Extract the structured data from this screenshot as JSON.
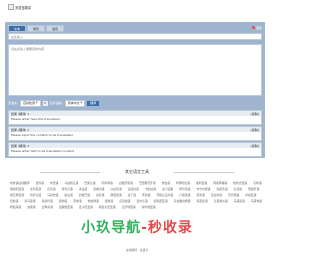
{
  "header": {
    "site_name": "多语言翻译"
  },
  "tabs": [
    "文本",
    "网页",
    "语音"
  ],
  "voice_label": "语音",
  "input_placeholder": "在此输入",
  "textarea_placeholder": "请在此输入要翻译的内容",
  "controls": {
    "from_label": "源语言:",
    "from_value": "自动检测",
    "to_label": "目标语言:",
    "to_value": "简体中文",
    "swap_symbol": "⇄",
    "translate_label": "翻译"
  },
  "results": [
    {
      "head": "结果 (翻译) 1",
      "action": "[复制]",
      "body": "Please enter here the translation"
    },
    {
      "head": "结果 (翻译) 2",
      "action": "[复制]",
      "body": "Please input the content to be translated"
    },
    {
      "head": "结果 (翻译) 3",
      "action": "[复制]",
      "body": "Please enter text to be translated content"
    }
  ],
  "section_title": "其它语言工具",
  "languages": [
    "布鲁语在线翻译",
    "世界语",
    "布里语",
    "乌兹别克语",
    "巴斯克语",
    "阿萨姆语",
    "白俄罗斯语",
    "巴西葡萄牙语",
    "米佐语",
    "阿姆哈拉语",
    "奥利亚语",
    "阿塞拜疆语",
    "格鲁吉亚语",
    "高棉语",
    "保加利亚语",
    "北印度语",
    "宿务语",
    "塔吉克语",
    "冰岛语",
    "夏威夷语",
    "瓜拉尼语",
    "孟加拉语",
    "卡纳达语",
    "泰卢固语",
    "库尔德语",
    "吉尔吉斯语",
    "旁遮普语",
    "信德语",
    "僧伽罗语",
    "斯瓦希里语",
    "哈萨克语",
    "马拉地语",
    "蒙古语",
    "约鲁巴语",
    "豪萨语",
    "弗里西语",
    "拉丁语",
    "老挝语",
    "苏格兰盖尔语",
    "卢森堡语",
    "毛利语",
    "尼泊尔语",
    "普什图语",
    "萨摩亚语",
    "绍纳语",
    "索马里语",
    "塞索托语",
    "巽他语",
    "南非语",
    "他加禄语",
    "祖鲁语",
    "意第绪语",
    "爱尔兰语",
    "加利西亚语",
    "马拉雅拉姆语",
    "科西嘉语",
    "克里奥尔语",
    "马其顿语",
    "马耳他语",
    "希伯来语",
    "波斯语",
    "立陶宛语",
    "拉脱维亚语",
    "爱沙尼亚语",
    "斯洛文尼亚语",
    "克罗地亚语",
    "塞尔维亚语"
  ],
  "watermark": {
    "part1": "小玖导航",
    "part2": "-秒收录"
  },
  "footer": "在线翻译 · 多语言"
}
